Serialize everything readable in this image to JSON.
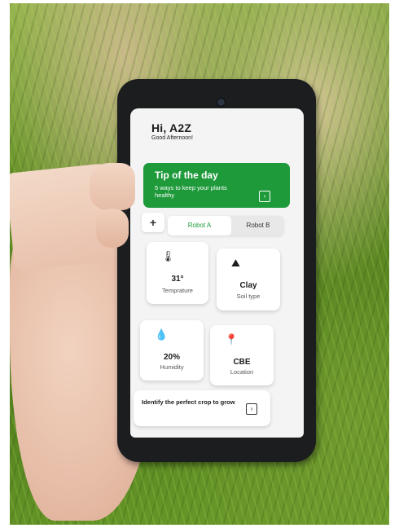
{
  "header": {
    "greeting": "Hi, A2Z",
    "subtitle": "Good Afternoon!"
  },
  "tip": {
    "title": "Tip of the day",
    "text": "5 ways to keep your plants healthy",
    "arrow": "›"
  },
  "add_button": "+",
  "tabs": [
    {
      "label": "Robot A"
    },
    {
      "label": "Robot B"
    }
  ],
  "cards": [
    {
      "icon": "thermometer-icon",
      "value": "31°",
      "label": "Temprature"
    },
    {
      "icon": "soil-icon",
      "value": "Clay",
      "label": "Soil type"
    },
    {
      "icon": "humidity-icon",
      "value": "20%",
      "label": "Humidity"
    },
    {
      "icon": "location-pin-icon",
      "value": "CBE",
      "label": "Location"
    }
  ],
  "crop": {
    "text": "Identify the perfect crop to grow",
    "arrow": "›"
  },
  "colors": {
    "accent": "#1e9a3b",
    "screen_bg": "#f4f4f4"
  }
}
